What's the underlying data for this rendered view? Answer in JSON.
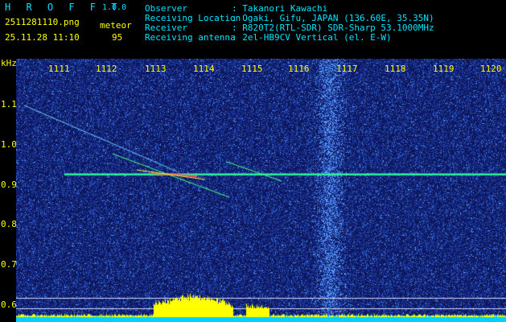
{
  "app": {
    "name": "H R O F F T",
    "version": "1.0.0"
  },
  "file": {
    "name": "2511281110.png",
    "timestamp": "25.11.28 11:10"
  },
  "detection": {
    "label": "meteor",
    "count": "95"
  },
  "info": [
    {
      "label": "Observer",
      "value": ": Takanori Kawachi"
    },
    {
      "label": "Receiving Location",
      "value": ": Ogaki, Gifu, JAPAN (136.60E, 35.35N)"
    },
    {
      "label": "Receiver",
      "value": ": R820T2(RTL-SDR) SDR-Sharp 53.1000MHz"
    },
    {
      "label": "Receiving antenna",
      "value": ": 2el-HB9CV Vertical (el. E-W)"
    }
  ],
  "axes": {
    "y_unit": "kHz",
    "time_ticks": [
      "1111",
      "1112",
      "1113",
      "1114",
      "1115",
      "1116",
      "1117",
      "1118",
      "1119",
      "1120"
    ],
    "freq_ticks": [
      "1.1",
      "1.0",
      "0.9",
      "0.8",
      "0.7",
      "0.6"
    ]
  },
  "colors": {
    "label": "#ffff00",
    "header": "#00e5ff",
    "background": "#000000",
    "carrier": "#00ff66",
    "bars": "#ffff00",
    "floor": "#00cfff"
  }
}
